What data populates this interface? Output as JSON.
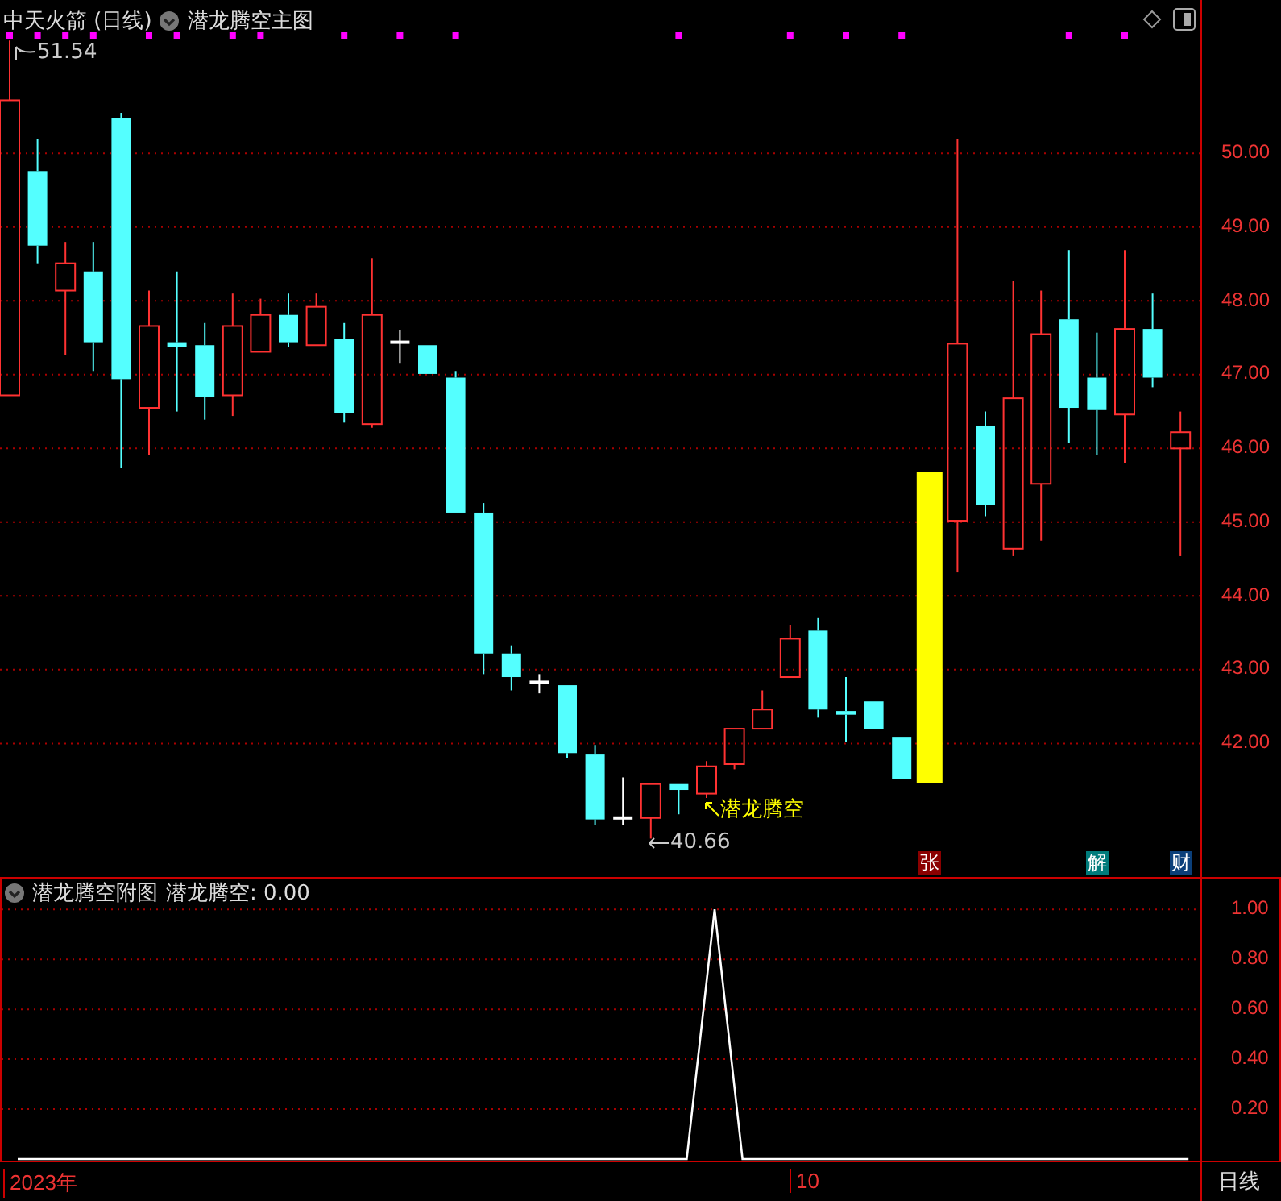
{
  "main_panel": {
    "stock": "中天火箭 (日线)",
    "indicator": "潜龙腾空主图",
    "high_marker": "51.54",
    "low_marker": "40.66",
    "signal_label": "潜龙腾空",
    "chart_data": {
      "type": "candlestick",
      "ylim": [
        40.19,
        52.08
      ],
      "grid": true,
      "yticks": [
        {
          "value": 50,
          "label": "50.00"
        },
        {
          "value": 49,
          "label": "49.00"
        },
        {
          "value": 48,
          "label": "48.00"
        },
        {
          "value": 47,
          "label": "47.00"
        },
        {
          "value": 46,
          "label": "46.00"
        },
        {
          "value": 45,
          "label": "45.00"
        },
        {
          "value": 44,
          "label": "44.00"
        },
        {
          "value": 43,
          "label": "43.00"
        },
        {
          "value": 42,
          "label": "42.00"
        }
      ],
      "ohlc": [
        [
          46.72,
          51.53,
          46.72,
          50.72
        ],
        [
          49.76,
          50.2,
          48.51,
          48.75
        ],
        [
          48.14,
          48.8,
          47.27,
          48.51
        ],
        [
          48.4,
          48.8,
          47.05,
          47.44
        ],
        [
          50.48,
          50.55,
          45.74,
          46.94
        ],
        [
          46.55,
          48.14,
          45.91,
          47.66
        ],
        [
          47.44,
          48.4,
          46.5,
          47.38
        ],
        [
          47.4,
          47.7,
          46.39,
          46.7
        ],
        [
          46.72,
          48.1,
          46.44,
          47.66
        ],
        [
          47.31,
          48.03,
          47.31,
          47.81
        ],
        [
          47.81,
          48.1,
          47.38,
          47.44
        ],
        [
          47.4,
          48.1,
          47.4,
          47.92
        ],
        [
          47.49,
          47.7,
          46.35,
          46.48
        ],
        [
          46.33,
          48.58,
          46.28,
          47.81
        ],
        [
          47.44,
          47.6,
          47.16,
          47.44
        ],
        [
          47.4,
          47.4,
          47.01,
          47.01
        ],
        [
          46.96,
          47.05,
          45.13,
          45.13
        ],
        [
          45.13,
          45.26,
          42.94,
          43.22
        ],
        [
          43.22,
          43.33,
          42.72,
          42.9
        ],
        [
          42.83,
          42.94,
          42.68,
          42.83
        ],
        [
          42.79,
          42.79,
          41.8,
          41.87
        ],
        [
          41.85,
          41.98,
          40.89,
          40.97
        ],
        [
          40.99,
          41.54,
          40.89,
          40.99
        ],
        [
          40.99,
          41.45,
          40.71,
          41.45
        ],
        [
          41.45,
          41.45,
          41.04,
          41.37
        ],
        [
          41.32,
          41.76,
          41.26,
          41.69
        ],
        [
          41.72,
          42.2,
          41.65,
          42.2
        ],
        [
          42.2,
          42.72,
          42.2,
          42.46
        ],
        [
          42.9,
          43.6,
          42.9,
          43.42
        ],
        [
          43.53,
          43.7,
          42.35,
          42.46
        ],
        [
          42.44,
          42.9,
          42.02,
          42.39
        ],
        [
          42.57,
          42.57,
          42.2,
          42.2
        ],
        [
          42.09,
          42.09,
          41.52,
          41.52
        ],
        null,
        [
          45.02,
          50.2,
          44.32,
          47.42
        ],
        [
          46.31,
          46.5,
          45.08,
          45.23
        ],
        [
          44.64,
          48.27,
          44.54,
          46.68
        ],
        [
          45.52,
          48.14,
          44.75,
          47.55
        ],
        [
          47.75,
          48.69,
          46.07,
          46.55
        ],
        [
          46.96,
          47.57,
          45.91,
          46.52
        ],
        [
          46.46,
          48.69,
          45.8,
          47.62
        ],
        [
          47.62,
          48.1,
          46.83,
          46.96
        ],
        [
          46.0,
          46.5,
          44.54,
          46.22
        ]
      ]
    },
    "event_badges": [
      {
        "label": "张",
        "color": "#8b0000"
      },
      {
        "label": "解",
        "color": "#007b7b"
      },
      {
        "label": "财",
        "color": "#0b3f7a"
      }
    ]
  },
  "sub_panel": {
    "title": "潜龙腾空附图",
    "reading": "潜龙腾空: 0.00",
    "chart_data": {
      "type": "line",
      "ylim": [
        0,
        1.13
      ],
      "grid": true,
      "yticks": [
        {
          "value": 1,
          "label": "1.00"
        },
        {
          "value": 0.8,
          "label": "0.80"
        },
        {
          "value": 0.6,
          "label": "0.60"
        },
        {
          "value": 0.4,
          "label": "0.40"
        },
        {
          "value": 0.2,
          "label": "0.20"
        }
      ],
      "series": [
        {
          "color": "#ffffff",
          "values": [
            0,
            0,
            0,
            0,
            0,
            0,
            0,
            0,
            0,
            0,
            0,
            0,
            0,
            0,
            0,
            0,
            0,
            0,
            0,
            0,
            0,
            0,
            0,
            0,
            0,
            1,
            0,
            0,
            0,
            0,
            0,
            0,
            0,
            0,
            0,
            0,
            0,
            0,
            0,
            0,
            0,
            0,
            0
          ]
        }
      ]
    }
  },
  "time_axis": {
    "labels": [
      "2023年",
      "10"
    ],
    "period": "日线"
  }
}
